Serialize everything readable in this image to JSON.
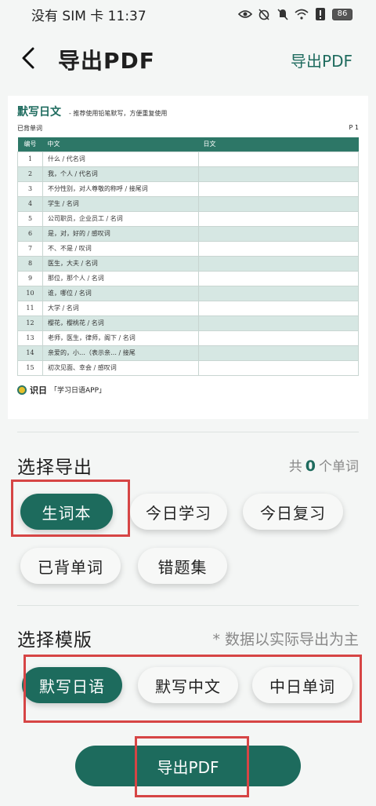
{
  "status": {
    "carrier_time": "没有 SIM 卡 11:37",
    "battery": "86"
  },
  "header": {
    "title": "导出PDF",
    "action": "导出PDF"
  },
  "preview": {
    "title": "默写日文",
    "subtitle": "- 推荐使用铅笔默写，方便重复使用",
    "list_name": "已背单词",
    "page": "P 1",
    "columns": [
      "编号",
      "中文",
      "日文"
    ],
    "rows": [
      {
        "num": "1",
        "zh": "什么 / 代名词"
      },
      {
        "num": "2",
        "zh": "我，个人 / 代名词"
      },
      {
        "num": "3",
        "zh": "不分性别，对人尊敬的称呼 / 接尾词"
      },
      {
        "num": "4",
        "zh": "学生 / 名词"
      },
      {
        "num": "5",
        "zh": "公司职员，企业员工 / 名词"
      },
      {
        "num": "6",
        "zh": "是，对，好的 / 感叹词"
      },
      {
        "num": "7",
        "zh": "不、不是 / 叹词"
      },
      {
        "num": "8",
        "zh": "医生，大夫 / 名词"
      },
      {
        "num": "9",
        "zh": "那位，那个人 / 名词"
      },
      {
        "num": "10",
        "zh": "谁，哪位 / 名词"
      },
      {
        "num": "11",
        "zh": "大学 / 名词"
      },
      {
        "num": "12",
        "zh": "樱花，樱桃花 / 名词"
      },
      {
        "num": "13",
        "zh": "老师，医生，律师，阁下 / 名词"
      },
      {
        "num": "14",
        "zh": "亲爱的，小…（表示亲… / 接尾"
      },
      {
        "num": "15",
        "zh": "初次见面、幸会 / 感叹词"
      }
    ],
    "brand": "识日",
    "brand_tag": "「学习日语APP」"
  },
  "export_section": {
    "title": "选择导出",
    "count_prefix": "共",
    "count": "0",
    "count_suffix": "个单词",
    "options": [
      "生词本",
      "今日学习",
      "今日复习",
      "已背单词",
      "错题集"
    ]
  },
  "template_section": {
    "title": "选择模版",
    "note": "* 数据以实际导出为主",
    "options": [
      "默写日语",
      "默写中文",
      "中日单词"
    ]
  },
  "export_button": "导出PDF",
  "colors": {
    "accent": "#1d6b5d",
    "highlight_box": "#d64545"
  }
}
